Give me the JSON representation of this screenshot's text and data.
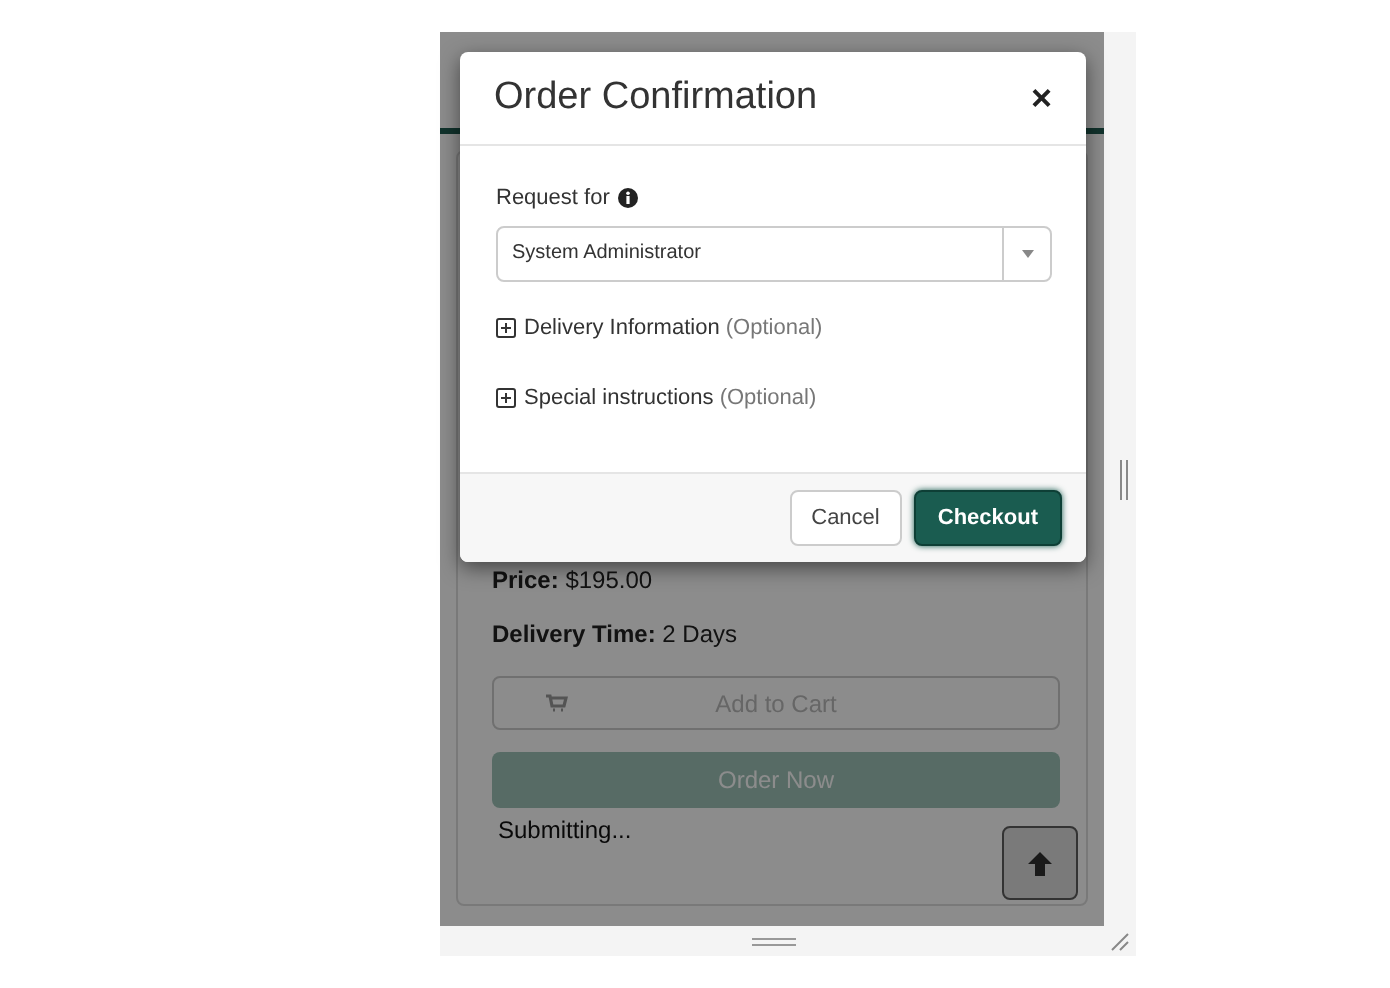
{
  "background_page": {
    "price": {
      "label": "Price:",
      "value": "$195.00"
    },
    "delivery_time": {
      "label": "Delivery Time:",
      "value": "2 Days"
    },
    "add_to_cart": {
      "label": "Add to Cart",
      "disabled": true
    },
    "order_now": {
      "label": "Order Now",
      "disabled": true
    },
    "status": "Submitting..."
  },
  "modal": {
    "title": "Order Confirmation",
    "close": "×",
    "request_for": {
      "label": "Request for",
      "value": "System Administrator"
    },
    "sections": [
      {
        "label": "Delivery Information",
        "hint": "(Optional)",
        "expanded": false
      },
      {
        "label": "Special instructions",
        "hint": "(Optional)",
        "expanded": false
      }
    ],
    "buttons": [
      {
        "label": "Cancel",
        "kind": "secondary"
      },
      {
        "label": "Checkout",
        "kind": "primary"
      }
    ]
  }
}
